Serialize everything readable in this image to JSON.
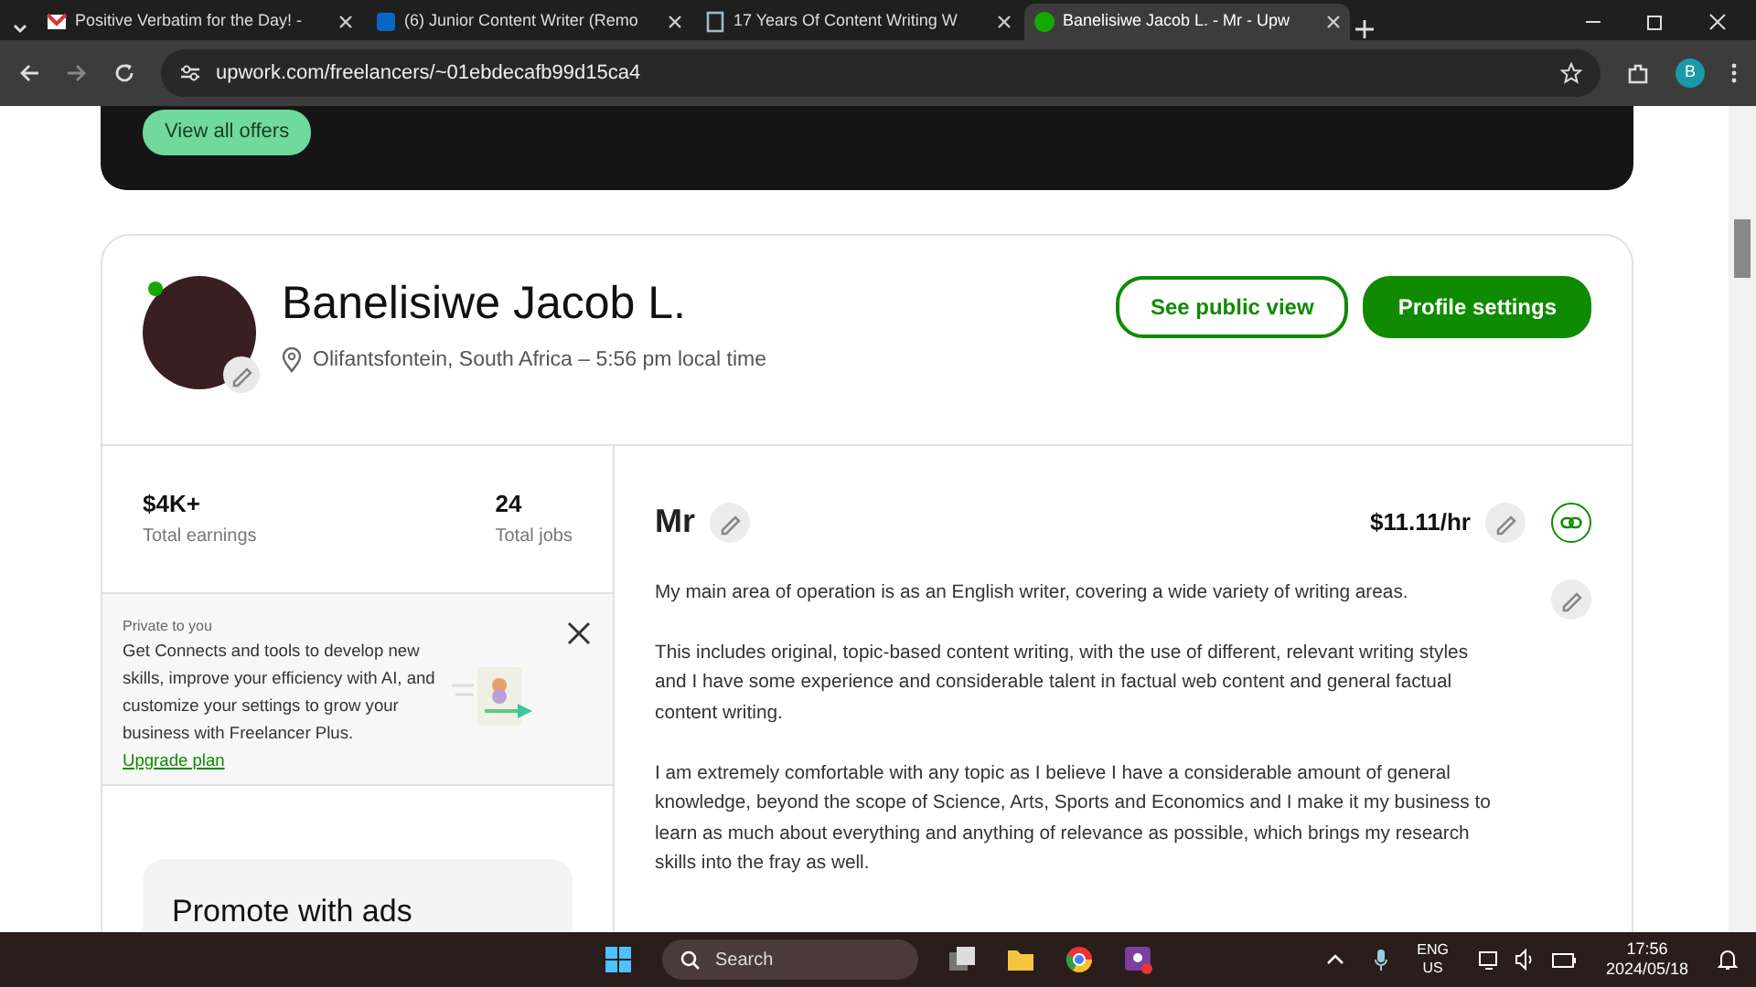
{
  "browser": {
    "tabs": [
      {
        "title": "Positive Verbatim for the Day! -",
        "kind": "mail",
        "selected": false
      },
      {
        "title": "(6) Junior Content Writer (Remo",
        "kind": "square",
        "selected": false
      },
      {
        "title": "17 Years Of Content Writing W",
        "kind": "page",
        "selected": false
      },
      {
        "title": "Banelisiwe Jacob L. - Mr - Upw",
        "kind": "circle",
        "selected": true
      }
    ],
    "url": "upwork.com/freelancers/~01ebdecafb99d15ca4",
    "profile_initial": "B"
  },
  "banner": {
    "button": "View all offers"
  },
  "profile": {
    "name": "Banelisiwe Jacob L.",
    "online": true,
    "location": "Olifantsfontein, South Africa – 5:56 pm local time",
    "buttons": [
      {
        "label": "See public view",
        "kind": "outline"
      },
      {
        "label": "Profile settings",
        "kind": "solid"
      }
    ]
  },
  "stats": [
    {
      "value": "$4K+",
      "label": "Total earnings"
    },
    {
      "value": "24",
      "label": "Total jobs"
    }
  ],
  "promo": {
    "tag": "Private to you",
    "text": "Get Connects and tools to develop new skills, improve your efficiency with AI, and customize your settings to grow your business with Freelancer Plus.",
    "link": "Upgrade plan"
  },
  "ads": {
    "title": "Promote with ads"
  },
  "overview": {
    "title": "Mr",
    "rate": "$11.11/hr",
    "paragraphs": [
      "My main area of operation is as an English writer, covering a wide variety of writing areas.",
      "This includes original, topic-based content writing, with the use of different, relevant writing styles and I have some experience and considerable talent in factual web content and general factual content writing.",
      "I am extremely comfortable with any topic as I believe I have a considerable amount of general knowledge, beyond the scope of Science, Arts, Sports and Economics and I make it my business to learn as much about everything and anything of relevance as possible, which brings my research skills into the fray as well."
    ]
  },
  "taskbar": {
    "search": "Search",
    "language": [
      "ENG",
      "US"
    ],
    "time": "17:56",
    "date": "2024/05/18"
  }
}
